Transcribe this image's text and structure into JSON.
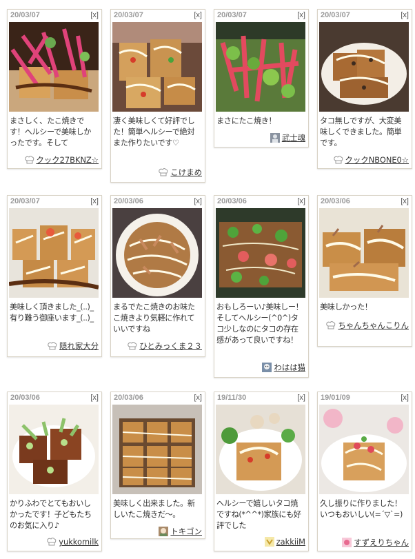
{
  "delete_label": "[x]",
  "colors": {
    "card_border": "#d9d3c6",
    "date_text": "#999999",
    "text": "#333333"
  },
  "cards": [
    {
      "date": "20/03/07",
      "comment": "まさしく、たこ焼きです！ヘルシーで美味しかったです。そして",
      "author": "クック27BKNZ☆",
      "icon": "chef-hat-icon"
    },
    {
      "date": "20/03/07",
      "comment": "凄く美味しくて好評でした！簡単ヘルシーで絶対また作りたいです♡",
      "author": "こけまめ",
      "icon": "chef-hat-icon"
    },
    {
      "date": "20/03/07",
      "comment": "まさにたこ焼き！",
      "author": "武士魂",
      "icon": "user-photo-icon"
    },
    {
      "date": "20/03/07",
      "comment": "タコ無しですが、大変美味しくできました。簡単です。",
      "author": "クックNBONE0☆",
      "icon": "chef-hat-icon"
    },
    {
      "date": "20/03/07",
      "comment": "美味しく頂きました_(..)_ 有り難う御座います_(..)_",
      "author": "隠れ家大分",
      "icon": "chef-hat-icon"
    },
    {
      "date": "20/03/06",
      "comment": "まるでたこ焼きのお味たこ焼きより気軽に作れていいですね",
      "author": "ひとみっくま２３",
      "icon": "chef-hat-icon"
    },
    {
      "date": "20/03/06",
      "comment": "おもしろーい♪美味しー！そしてヘルシー(^0^)タコ少しなのにタコの存在感があって良いですね！",
      "author": "わはは猫",
      "icon": "user-photo-icon"
    },
    {
      "date": "20/03/06",
      "comment": "美味しかった！",
      "author": "ちゃんちゃんこりん",
      "icon": "chef-hat-icon"
    },
    {
      "date": "20/03/06",
      "comment": "かりふわでとてもおいしかったです！子どもたちのお気に入り♪",
      "author": "yukkomilk",
      "icon": "chef-hat-icon"
    },
    {
      "date": "20/03/06",
      "comment": "美味しく出来ました。新しいたこ焼きだ〜。",
      "author": "トキゴン",
      "icon": "user-photo-icon"
    },
    {
      "date": "19/11/30",
      "comment": "ヘルシーで嬉しいタコ焼ですね(*^^*)家族にも好評でした",
      "author": "zakkiiM",
      "icon": "user-photo-icon"
    },
    {
      "date": "19/01/09",
      "comment": "久し振りに作りました！いつもおいしい(=´▽`=)",
      "author": "すずえりちゃん",
      "icon": "user-photo-icon"
    }
  ]
}
